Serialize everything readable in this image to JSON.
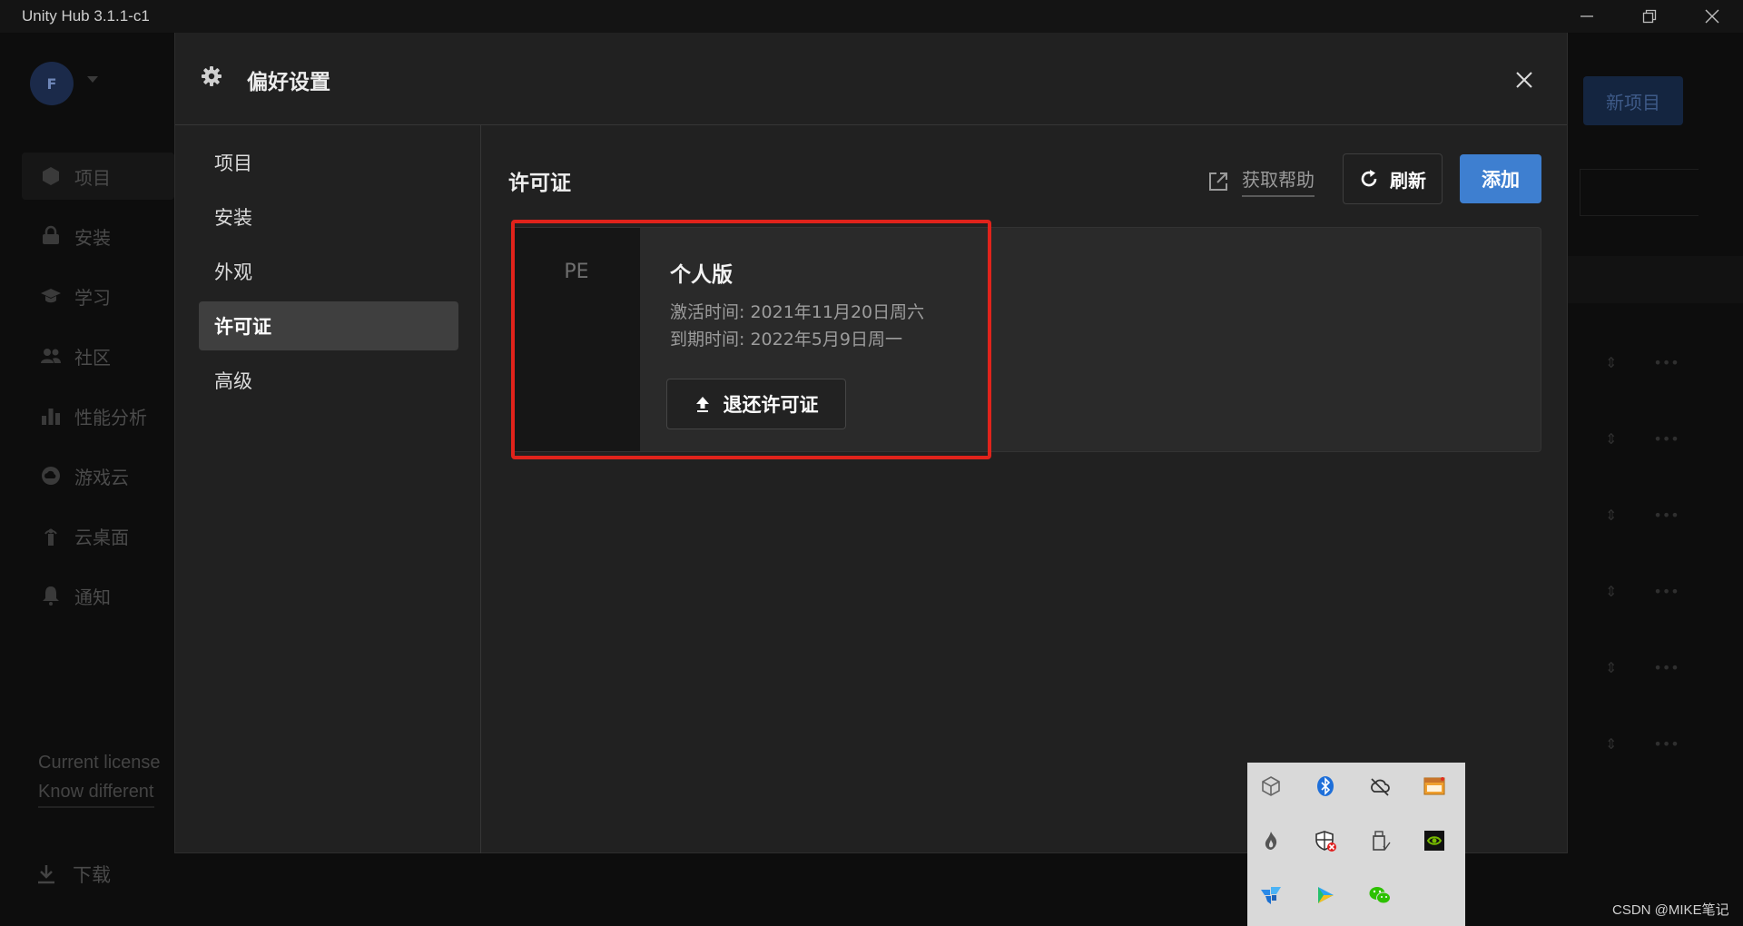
{
  "window": {
    "title": "Unity Hub 3.1.1-c1"
  },
  "background": {
    "avatar_initial": "F",
    "nav": [
      {
        "label": "项目",
        "icon": "cube-icon"
      },
      {
        "label": "安装",
        "icon": "lock-icon"
      },
      {
        "label": "学习",
        "icon": "graduation-cap-icon"
      },
      {
        "label": "社区",
        "icon": "people-icon"
      },
      {
        "label": "性能分析",
        "icon": "bar-chart-icon"
      },
      {
        "label": "游戏云",
        "icon": "cloud-icon"
      },
      {
        "label": "云桌面",
        "icon": "broadcast-icon"
      },
      {
        "label": "通知",
        "icon": "bell-icon"
      }
    ],
    "license_line1": "Current license",
    "license_line2": "Know different",
    "download_label": "下载",
    "new_project_label": "新项目"
  },
  "modal": {
    "title": "偏好设置",
    "menu": [
      {
        "label": "项目",
        "active": false
      },
      {
        "label": "安装",
        "active": false
      },
      {
        "label": "外观",
        "active": false
      },
      {
        "label": "许可证",
        "active": true
      },
      {
        "label": "高级",
        "active": false
      }
    ],
    "content": {
      "title": "许可证",
      "help_label": "获取帮助",
      "refresh_label": "刷新",
      "add_label": "添加",
      "license": {
        "badge": "PE",
        "name": "个人版",
        "activated": "激活时间: 2021年11月20日周六",
        "expires": "到期时间: 2022年5月9日周一",
        "return_label": "退还许可证"
      }
    }
  },
  "tray": {
    "icons": [
      "unity-cube-icon",
      "bluetooth-icon",
      "cloud-offline-icon",
      "window-app-icon",
      "flame-icon",
      "security-shield-icon",
      "usb-drive-icon",
      "nvidia-icon",
      "pinwheel-icon",
      "video-player-icon",
      "wechat-icon"
    ]
  },
  "watermark": "CSDN @MIKE笔记",
  "colors": {
    "accent": "#3e7fd0",
    "highlight": "#e0231b",
    "modal_bg": "#212121"
  }
}
